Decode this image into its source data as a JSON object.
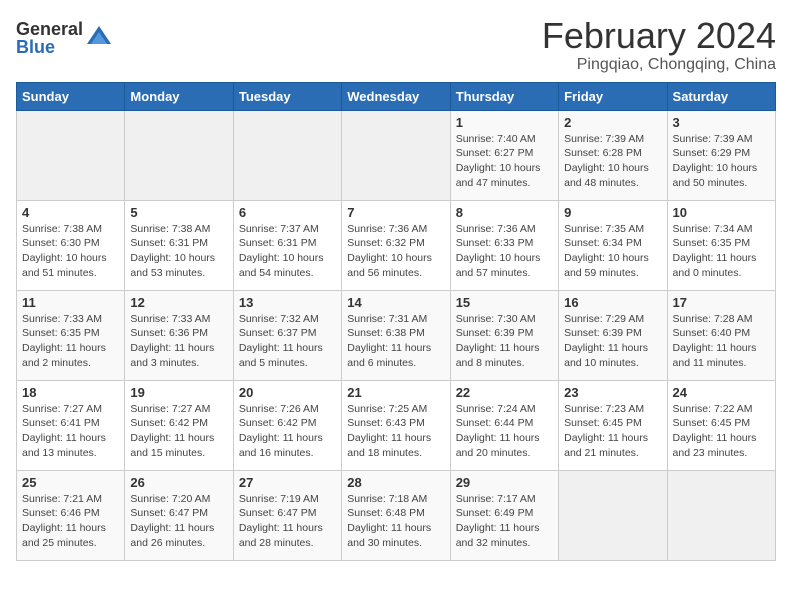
{
  "logo": {
    "general": "General",
    "blue": "Blue"
  },
  "header": {
    "title": "February 2024",
    "subtitle": "Pingqiao, Chongqing, China"
  },
  "days_of_week": [
    "Sunday",
    "Monday",
    "Tuesday",
    "Wednesday",
    "Thursday",
    "Friday",
    "Saturday"
  ],
  "weeks": [
    [
      {
        "day": "",
        "info": ""
      },
      {
        "day": "",
        "info": ""
      },
      {
        "day": "",
        "info": ""
      },
      {
        "day": "",
        "info": ""
      },
      {
        "day": "1",
        "info": "Sunrise: 7:40 AM\nSunset: 6:27 PM\nDaylight: 10 hours\nand 47 minutes."
      },
      {
        "day": "2",
        "info": "Sunrise: 7:39 AM\nSunset: 6:28 PM\nDaylight: 10 hours\nand 48 minutes."
      },
      {
        "day": "3",
        "info": "Sunrise: 7:39 AM\nSunset: 6:29 PM\nDaylight: 10 hours\nand 50 minutes."
      }
    ],
    [
      {
        "day": "4",
        "info": "Sunrise: 7:38 AM\nSunset: 6:30 PM\nDaylight: 10 hours\nand 51 minutes."
      },
      {
        "day": "5",
        "info": "Sunrise: 7:38 AM\nSunset: 6:31 PM\nDaylight: 10 hours\nand 53 minutes."
      },
      {
        "day": "6",
        "info": "Sunrise: 7:37 AM\nSunset: 6:31 PM\nDaylight: 10 hours\nand 54 minutes."
      },
      {
        "day": "7",
        "info": "Sunrise: 7:36 AM\nSunset: 6:32 PM\nDaylight: 10 hours\nand 56 minutes."
      },
      {
        "day": "8",
        "info": "Sunrise: 7:36 AM\nSunset: 6:33 PM\nDaylight: 10 hours\nand 57 minutes."
      },
      {
        "day": "9",
        "info": "Sunrise: 7:35 AM\nSunset: 6:34 PM\nDaylight: 10 hours\nand 59 minutes."
      },
      {
        "day": "10",
        "info": "Sunrise: 7:34 AM\nSunset: 6:35 PM\nDaylight: 11 hours\nand 0 minutes."
      }
    ],
    [
      {
        "day": "11",
        "info": "Sunrise: 7:33 AM\nSunset: 6:35 PM\nDaylight: 11 hours\nand 2 minutes."
      },
      {
        "day": "12",
        "info": "Sunrise: 7:33 AM\nSunset: 6:36 PM\nDaylight: 11 hours\nand 3 minutes."
      },
      {
        "day": "13",
        "info": "Sunrise: 7:32 AM\nSunset: 6:37 PM\nDaylight: 11 hours\nand 5 minutes."
      },
      {
        "day": "14",
        "info": "Sunrise: 7:31 AM\nSunset: 6:38 PM\nDaylight: 11 hours\nand 6 minutes."
      },
      {
        "day": "15",
        "info": "Sunrise: 7:30 AM\nSunset: 6:39 PM\nDaylight: 11 hours\nand 8 minutes."
      },
      {
        "day": "16",
        "info": "Sunrise: 7:29 AM\nSunset: 6:39 PM\nDaylight: 11 hours\nand 10 minutes."
      },
      {
        "day": "17",
        "info": "Sunrise: 7:28 AM\nSunset: 6:40 PM\nDaylight: 11 hours\nand 11 minutes."
      }
    ],
    [
      {
        "day": "18",
        "info": "Sunrise: 7:27 AM\nSunset: 6:41 PM\nDaylight: 11 hours\nand 13 minutes."
      },
      {
        "day": "19",
        "info": "Sunrise: 7:27 AM\nSunset: 6:42 PM\nDaylight: 11 hours\nand 15 minutes."
      },
      {
        "day": "20",
        "info": "Sunrise: 7:26 AM\nSunset: 6:42 PM\nDaylight: 11 hours\nand 16 minutes."
      },
      {
        "day": "21",
        "info": "Sunrise: 7:25 AM\nSunset: 6:43 PM\nDaylight: 11 hours\nand 18 minutes."
      },
      {
        "day": "22",
        "info": "Sunrise: 7:24 AM\nSunset: 6:44 PM\nDaylight: 11 hours\nand 20 minutes."
      },
      {
        "day": "23",
        "info": "Sunrise: 7:23 AM\nSunset: 6:45 PM\nDaylight: 11 hours\nand 21 minutes."
      },
      {
        "day": "24",
        "info": "Sunrise: 7:22 AM\nSunset: 6:45 PM\nDaylight: 11 hours\nand 23 minutes."
      }
    ],
    [
      {
        "day": "25",
        "info": "Sunrise: 7:21 AM\nSunset: 6:46 PM\nDaylight: 11 hours\nand 25 minutes."
      },
      {
        "day": "26",
        "info": "Sunrise: 7:20 AM\nSunset: 6:47 PM\nDaylight: 11 hours\nand 26 minutes."
      },
      {
        "day": "27",
        "info": "Sunrise: 7:19 AM\nSunset: 6:47 PM\nDaylight: 11 hours\nand 28 minutes."
      },
      {
        "day": "28",
        "info": "Sunrise: 7:18 AM\nSunset: 6:48 PM\nDaylight: 11 hours\nand 30 minutes."
      },
      {
        "day": "29",
        "info": "Sunrise: 7:17 AM\nSunset: 6:49 PM\nDaylight: 11 hours\nand 32 minutes."
      },
      {
        "day": "",
        "info": ""
      },
      {
        "day": "",
        "info": ""
      }
    ]
  ]
}
